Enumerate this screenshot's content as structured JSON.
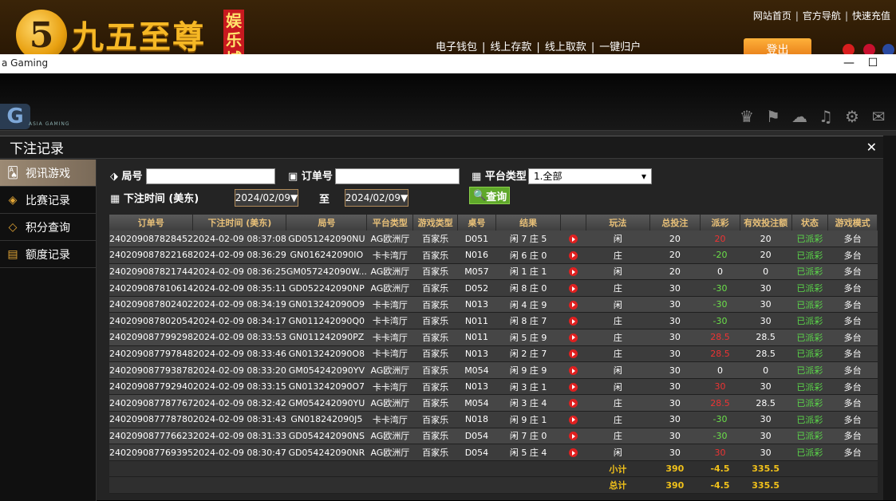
{
  "banner": {
    "brand": "九五至尊",
    "brand_tag": [
      "娱",
      "乐",
      "城"
    ],
    "top_links": [
      "网站首页",
      "官方导航",
      "快速充值"
    ],
    "sub_links": [
      "电子钱包",
      "线上存款",
      "线上取款",
      "一键归户"
    ],
    "logout": "登出"
  },
  "window": {
    "title": "a Gaming",
    "minimize": "—",
    "maximize": "☐"
  },
  "ag": {
    "logo": "G",
    "logo_text": "ASIA GAMING"
  },
  "modal": {
    "title": "下注记录",
    "close": "✕"
  },
  "sidebar": {
    "items": [
      {
        "label": "视讯游戏",
        "icon": "cards-icon"
      },
      {
        "label": "比赛记录",
        "icon": "ticket-icon"
      },
      {
        "label": "积分查询",
        "icon": "diamond-icon"
      },
      {
        "label": "额度记录",
        "icon": "document-icon"
      }
    ]
  },
  "filters": {
    "round_label": "局号",
    "order_label": "订单号",
    "platform_label": "平台类型",
    "platform_value": "1.全部",
    "time_label": "下注时间 (美东)",
    "date_from": "2024/02/09▼",
    "to_label": "至",
    "date_to": "2024/02/09▼",
    "query": "查询"
  },
  "table": {
    "headers": [
      "订单号",
      "下注时间 (美东)",
      "局号",
      "平台类型",
      "游戏类型",
      "桌号",
      "结果",
      "",
      "玩法",
      "总投注",
      "派彩",
      "有效投注额",
      "状态",
      "游戏模式"
    ],
    "rows": [
      [
        "240209087828452",
        "2024-02-09 08:37:08",
        "GD051242090NU",
        "AG欧洲厅",
        "百家乐",
        "D051",
        "闲 7 庄 5",
        "",
        "闲",
        "20",
        "20",
        "20",
        "已派彩",
        "多台"
      ],
      [
        "240209087822168",
        "2024-02-09 08:36:29",
        "GN016242090IO",
        "卡卡湾厅",
        "百家乐",
        "N016",
        "闲 6 庄 0",
        "",
        "庄",
        "20",
        "-20",
        "20",
        "已派彩",
        "多台"
      ],
      [
        "240209087821744",
        "2024-02-09 08:36:25",
        "GM057242090W...",
        "AG欧洲厅",
        "百家乐",
        "M057",
        "闲 1 庄 1",
        "",
        "闲",
        "20",
        "0",
        "0",
        "已派彩",
        "多台"
      ],
      [
        "240209087810614",
        "2024-02-09 08:35:11",
        "GD052242090NP",
        "AG欧洲厅",
        "百家乐",
        "D052",
        "闲 8 庄 0",
        "",
        "庄",
        "30",
        "-30",
        "30",
        "已派彩",
        "多台"
      ],
      [
        "240209087802402",
        "2024-02-09 08:34:19",
        "GN013242090O9",
        "卡卡湾厅",
        "百家乐",
        "N013",
        "闲 4 庄 9",
        "",
        "闲",
        "30",
        "-30",
        "30",
        "已派彩",
        "多台"
      ],
      [
        "240209087802054",
        "2024-02-09 08:34:17",
        "GN011242090Q0",
        "卡卡湾厅",
        "百家乐",
        "N011",
        "闲 8 庄 7",
        "",
        "庄",
        "30",
        "-30",
        "30",
        "已派彩",
        "多台"
      ],
      [
        "240209087799298",
        "2024-02-09 08:33:53",
        "GN011242090PZ",
        "卡卡湾厅",
        "百家乐",
        "N011",
        "闲 5 庄 9",
        "",
        "庄",
        "30",
        "28.5",
        "28.5",
        "已派彩",
        "多台"
      ],
      [
        "240209087797848",
        "2024-02-09 08:33:46",
        "GN013242090O8",
        "卡卡湾厅",
        "百家乐",
        "N013",
        "闲 2 庄 7",
        "",
        "庄",
        "30",
        "28.5",
        "28.5",
        "已派彩",
        "多台"
      ],
      [
        "240209087793878",
        "2024-02-09 08:33:20",
        "GM054242090YV",
        "AG欧洲厅",
        "百家乐",
        "M054",
        "闲 9 庄 9",
        "",
        "闲",
        "30",
        "0",
        "0",
        "已派彩",
        "多台"
      ],
      [
        "240209087792940",
        "2024-02-09 08:33:15",
        "GN013242090O7",
        "卡卡湾厅",
        "百家乐",
        "N013",
        "闲 3 庄 1",
        "",
        "闲",
        "30",
        "30",
        "30",
        "已派彩",
        "多台"
      ],
      [
        "240209087787767",
        "2024-02-09 08:32:42",
        "GM054242090YU",
        "AG欧洲厅",
        "百家乐",
        "M054",
        "闲 3 庄 4",
        "",
        "庄",
        "30",
        "28.5",
        "28.5",
        "已派彩",
        "多台"
      ],
      [
        "240209087778780",
        "2024-02-09 08:31:43",
        "GN018242090J5",
        "卡卡湾厅",
        "百家乐",
        "N018",
        "闲 9 庄 1",
        "",
        "庄",
        "30",
        "-30",
        "30",
        "已派彩",
        "多台"
      ],
      [
        "240209087776623",
        "2024-02-09 08:31:33",
        "GD054242090NS",
        "AG欧洲厅",
        "百家乐",
        "D054",
        "闲 7 庄 0",
        "",
        "庄",
        "30",
        "-30",
        "30",
        "已派彩",
        "多台"
      ],
      [
        "240209087769395",
        "2024-02-09 08:30:47",
        "GD054242090NR",
        "AG欧洲厅",
        "百家乐",
        "D054",
        "闲 5 庄 4",
        "",
        "闲",
        "30",
        "30",
        "30",
        "已派彩",
        "多台"
      ]
    ],
    "subtotal": {
      "label": "小计",
      "bet": "390",
      "payout": "-4.5",
      "valid": "335.5"
    },
    "total": {
      "label": "总计",
      "bet": "390",
      "payout": "-4.5",
      "valid": "335.5"
    }
  },
  "colors": {
    "accent": "#e8c078",
    "positive": "#e33333",
    "negative": "#6be04a",
    "status": "#5bd84a",
    "sum": "#f2c21a"
  }
}
